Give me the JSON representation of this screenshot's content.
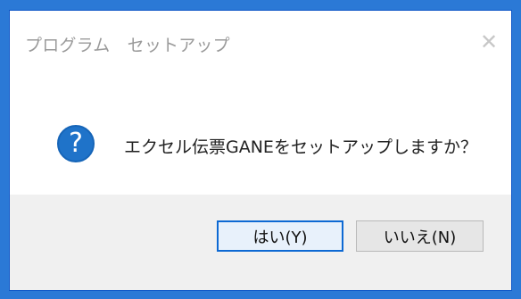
{
  "dialog": {
    "title": "プログラム　セットアップ",
    "close_glyph": "✕",
    "icon_glyph": "?",
    "icon_name": "question-icon",
    "message": "エクセル伝票GANEをセットアップしますか？",
    "buttons": {
      "yes_label": "はい(Y)",
      "no_label": "いいえ(N)"
    }
  },
  "colors": {
    "desktop_blue": "#2b79d6",
    "dialog_border": "#0d56c7",
    "button_bar": "#f0f0f0",
    "icon_blue": "#1f73c9",
    "primary_button_border": "#0d69d3",
    "primary_button_bg": "#e8f1fb"
  }
}
